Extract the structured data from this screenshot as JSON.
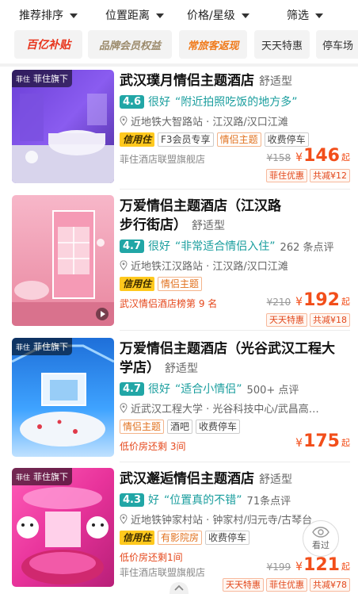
{
  "sort_bar": {
    "items": [
      {
        "label": "推荐排序"
      },
      {
        "label": "位置距离"
      },
      {
        "label": "价格/星级"
      },
      {
        "label": "筛选"
      }
    ]
  },
  "chips": [
    {
      "label": "百亿补贴"
    },
    {
      "label": "品牌会员权益"
    },
    {
      "label": "常旅客返现"
    },
    {
      "label": "天天特惠"
    },
    {
      "label": "停车场"
    }
  ],
  "hotels": [
    {
      "brand_tag": "菲住旗下",
      "name": "武汉璞月情侣主题酒店",
      "tier": "舒适型",
      "score": "4.6",
      "score_word": "很好",
      "quote": "“附近拍照吃饭的地方多”",
      "review_count": "",
      "location": "近地铁大智路站 · 江汉路/汉口江滩",
      "tags": [
        "信用住",
        "F3会员专享",
        "情侣主题",
        "收费停车"
      ],
      "note": "菲住酒店联盟旗舰店",
      "old_price": "¥158",
      "yen": "¥",
      "price": "146",
      "qi": "起",
      "promos": [
        "菲住优惠",
        "共减¥12"
      ]
    },
    {
      "brand_tag": "",
      "name_line1": "万爱情侣主题酒店（江汉路",
      "name_line2": "步行街店）",
      "tier": "舒适型",
      "score": "4.7",
      "score_word": "很好",
      "quote": "“非常适合情侣入住”",
      "review_count": "262 条点评",
      "location": "近地铁江汉路站 · 江汉路/汉口江滩",
      "tags": [
        "信用住",
        "情侣主题"
      ],
      "note": "武汉情侣酒店榜第 9 名",
      "old_price": "¥210",
      "yen": "¥",
      "price": "192",
      "qi": "起",
      "promos": [
        "天天特惠",
        "共减¥18"
      ]
    },
    {
      "brand_tag": "菲住旗下",
      "name_line1": "万爱情侣主题酒店（光谷武汉工程大",
      "name_line2": "学店）",
      "tier": "舒适型",
      "score": "4.7",
      "score_word": "很好",
      "quote": "“适合小情侣”",
      "review_count": "500+ 点评",
      "location": "近武汉工程大学 · 光谷科技中心/武昌高…",
      "tags": [
        "情侣主题",
        "酒吧",
        "收费停车"
      ],
      "note": "低价房还剩 3间",
      "old_price": "",
      "yen": "¥",
      "price": "175",
      "qi": "起",
      "promos": []
    },
    {
      "brand_tag": "菲住旗下",
      "name": "武汉邂逅情侣主题酒店",
      "tier": "舒适型",
      "score": "4.3",
      "score_word": "好",
      "quote": "“位置真的不错”",
      "review_count": "71条点评",
      "location": "近地铁钟家村站 · 钟家村/归元寺/古琴台",
      "tags": [
        "信用住",
        "有影院房",
        "收费停车"
      ],
      "note": "低价房还剩1间",
      "note2": "菲住酒店联盟旗舰店",
      "old_price": "¥199",
      "yen": "¥",
      "price": "121",
      "qi": "起",
      "promos": [
        "天天特惠",
        "菲住优惠",
        "共减¥78"
      ]
    }
  ],
  "viewed_button": {
    "label": "看过"
  },
  "colors": {
    "accent_orange": "#f24e1a",
    "teal": "#21a6a6",
    "xinyong_yellow": "#ffc91e"
  }
}
